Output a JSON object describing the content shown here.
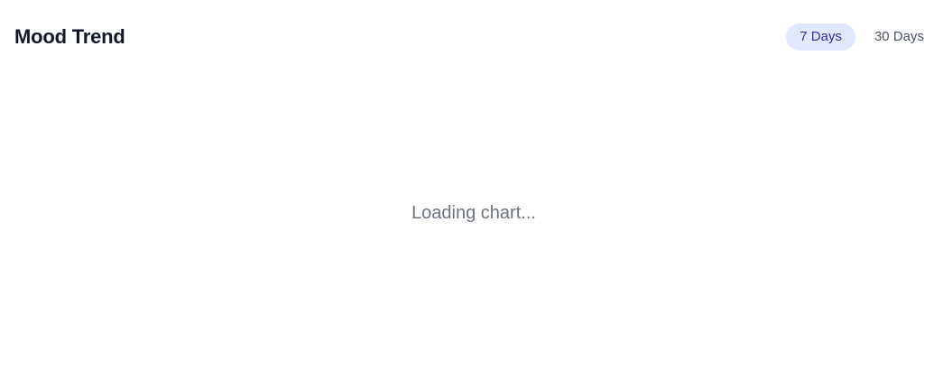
{
  "header": {
    "title": "Mood Trend"
  },
  "range_toggle": {
    "options": [
      {
        "label": "7 Days",
        "active": true
      },
      {
        "label": "30 Days",
        "active": false
      }
    ]
  },
  "chart": {
    "loading_text": "Loading chart..."
  },
  "colors": {
    "active_pill_bg": "#e0e7ff",
    "active_pill_text": "#3730a3",
    "muted_text": "#6b7280",
    "title_text": "#111827"
  }
}
